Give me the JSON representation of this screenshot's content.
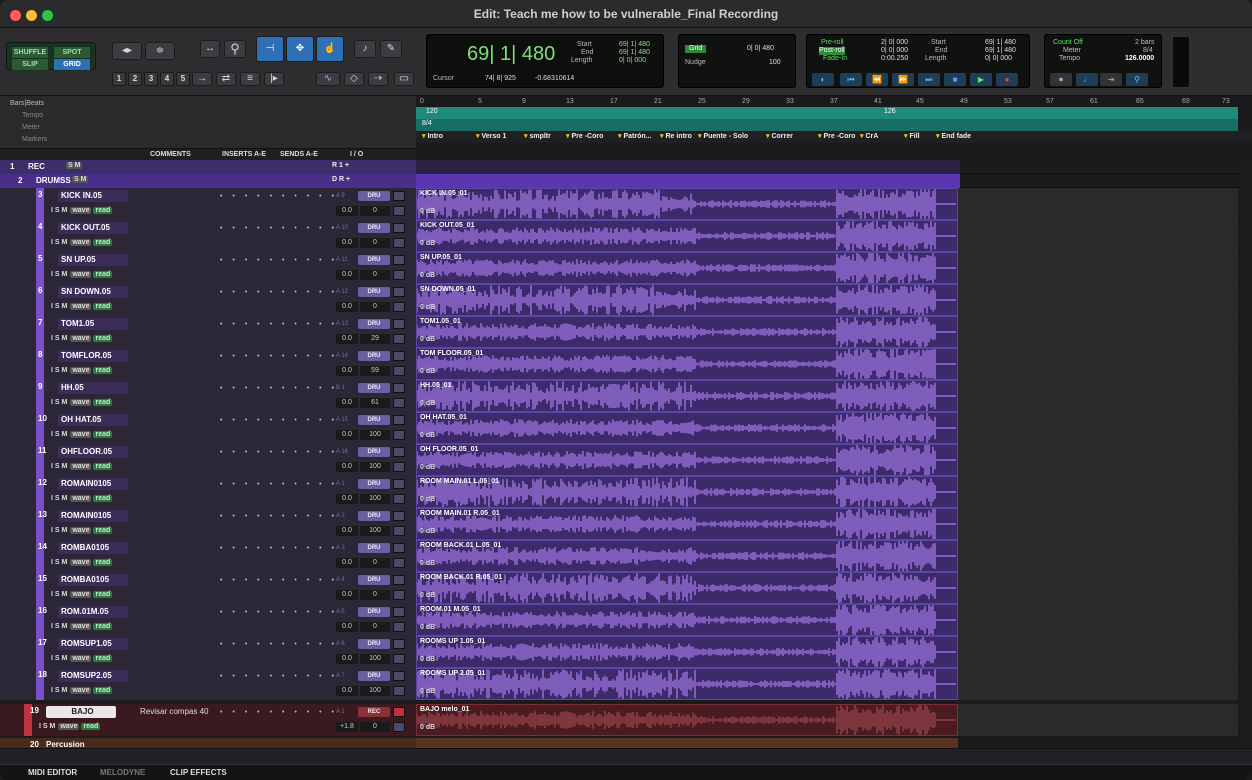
{
  "window": {
    "title": "Edit: Teach me how to be vulnerable_Final Recording"
  },
  "toolbar": {
    "modes": [
      "SHUFFLE",
      "SPOT",
      "SLIP",
      "GRID"
    ],
    "grid_nums": [
      "1",
      "2",
      "3",
      "4",
      "5"
    ],
    "counter": {
      "main": "69| 1| 480",
      "start_label": "Start",
      "start": "69| 1| 480",
      "end_label": "End",
      "end": "69| 1| 480",
      "length_label": "Length",
      "length": "0| 0| 000",
      "cursor_label": "Cursor",
      "cursor": "74| 8| 925",
      "cursor_db": "-0.68310614"
    },
    "grid": {
      "label": "Grid",
      "value": "0| 0| 480",
      "nudge_label": "Nudge",
      "nudge": "100"
    },
    "preroll": {
      "pre_label": "Pre-roll",
      "pre": "2| 0| 000",
      "post_label": "Post-roll",
      "post": "0| 0| 000",
      "fade_label": "Fade-In",
      "fade": "0:00.250",
      "start_label": "Start",
      "start": "69| 1| 480",
      "end_label": "End",
      "end": "69| 1| 480",
      "length_label": "Length",
      "length": "0| 0| 000"
    },
    "count": {
      "label": "Count Off",
      "bars": "2 bars",
      "meter_label": "Meter",
      "meter": "8/4",
      "tempo_label": "Tempo",
      "tempo": "126.0000"
    }
  },
  "rulers": {
    "barsbeats": "Bars|Beats",
    "tempo": "Tempo",
    "meter": "Meter",
    "markers": "Markers",
    "bars": [
      "0",
      "5",
      "9",
      "13",
      "17",
      "21",
      "25",
      "29",
      "33",
      "37",
      "41",
      "45",
      "49",
      "53",
      "57",
      "61",
      "65",
      "69",
      "73"
    ],
    "tempo_a": "120",
    "tempo_b": "126",
    "meter_val": "8/4",
    "marker_list": [
      {
        "label": "Intro"
      },
      {
        "label": "Verso 1"
      },
      {
        "label": "smpltr"
      },
      {
        "label": "Pre -Coro"
      },
      {
        "label": "Patrón..."
      },
      {
        "label": "Re intro"
      },
      {
        "label": "Puente - Solo"
      },
      {
        "label": "Correr"
      },
      {
        "label": "Pre -Coro"
      },
      {
        "label": "CrA"
      },
      {
        "label": "Fill"
      },
      {
        "label": "End fade"
      }
    ]
  },
  "columns": {
    "comments": "COMMENTS",
    "inserts": "INSERTS A-E",
    "sends": "SENDS A-E",
    "io": "I / O"
  },
  "groups": [
    {
      "num": "1",
      "name": "REC",
      "flags": "S M",
      "io": "R 1 +"
    },
    {
      "num": "2",
      "name": "DRUMSS",
      "flags": "S M",
      "io": "D R +"
    }
  ],
  "tracks": [
    {
      "num": "3",
      "name": "KICK IN.05",
      "clip": "KICK IN.05_01",
      "gain": "0 dB",
      "input": "A 9",
      "out": "DRU",
      "vol": "0.0",
      "pan": "0"
    },
    {
      "num": "4",
      "name": "KICK OUT.05",
      "clip": "KICK OUT.05_01",
      "gain": "0 dB",
      "input": "A 10",
      "out": "DRU",
      "vol": "0.0",
      "pan": "0"
    },
    {
      "num": "5",
      "name": "SN UP.05",
      "clip": "SN UP.05_01",
      "gain": "0 dB",
      "input": "A 11",
      "out": "DRU",
      "vol": "0.0",
      "pan": "0"
    },
    {
      "num": "6",
      "name": "SN DOWN.05",
      "clip": "SN DOWN.05_01",
      "gain": "0 dB",
      "input": "A 12",
      "out": "DRU",
      "vol": "0.0",
      "pan": "0"
    },
    {
      "num": "7",
      "name": "TOM1.05",
      "clip": "TOM1.05_01",
      "gain": "0 dB",
      "input": "A 13",
      "out": "DRU",
      "vol": "0.0",
      "pan": "29"
    },
    {
      "num": "8",
      "name": "TOMFLOR.05",
      "clip": "TOM FLOOR.05_01",
      "gain": "0 dB",
      "input": "A 14",
      "out": "DRU",
      "vol": "0.0",
      "pan": "59"
    },
    {
      "num": "9",
      "name": "HH.05",
      "clip": "HH.05_01",
      "gain": "0 dB",
      "input": "B 1",
      "out": "DRU",
      "vol": "0.0",
      "pan": "61"
    },
    {
      "num": "10",
      "name": "OH HAT.05",
      "clip": "OH HAT.05_01",
      "gain": "0 dB",
      "input": "A 15",
      "out": "DRU",
      "vol": "0.0",
      "pan": "100"
    },
    {
      "num": "11",
      "name": "OHFLOOR.05",
      "clip": "OH FLOOR.05_01",
      "gain": "0 dB",
      "input": "A 16",
      "out": "DRU",
      "vol": "0.0",
      "pan": "100"
    },
    {
      "num": "12",
      "name": "ROMAIN0105",
      "clip": "ROOM MAIN.01 L.05_01",
      "gain": "0 dB",
      "input": "A 1",
      "out": "DRU",
      "vol": "0.0",
      "pan": "100"
    },
    {
      "num": "13",
      "name": "ROMAIN0105",
      "clip": "ROOM MAIN.01 R.05_01",
      "gain": "0 dB",
      "input": "A 2",
      "out": "DRU",
      "vol": "0.0",
      "pan": "100"
    },
    {
      "num": "14",
      "name": "ROMBA0105",
      "clip": "ROOM BACK.01 L.05_01",
      "gain": "0 dB",
      "input": "A 3",
      "out": "DRU",
      "vol": "0.0",
      "pan": "0"
    },
    {
      "num": "15",
      "name": "ROMBA0105",
      "clip": "ROOM BACK.01 R.05_01",
      "gain": "0 dB",
      "input": "A 4",
      "out": "DRU",
      "vol": "0.0",
      "pan": "0"
    },
    {
      "num": "16",
      "name": "ROM.01M.05",
      "clip": "ROOM.01 M.05_01",
      "gain": "0 dB",
      "input": "A 5",
      "out": "DRU",
      "vol": "0.0",
      "pan": "0"
    },
    {
      "num": "17",
      "name": "ROMSUP1.05",
      "clip": "ROOMS UP 1.05_01",
      "gain": "0 dB",
      "input": "A 6",
      "out": "DRU",
      "vol": "0.0",
      "pan": "100"
    },
    {
      "num": "18",
      "name": "ROMSUP2.05",
      "clip": "ROOMS UP 2.05_01",
      "gain": "0 dB",
      "input": "A 7",
      "out": "DRU",
      "vol": "0.0",
      "pan": "100"
    }
  ],
  "track_flags": {
    "ism": "I S M",
    "wave": "wave",
    "read": "read"
  },
  "bass": {
    "num": "19",
    "name": "BAJO",
    "comment": "Revisar compas 40",
    "clip": "BAJO melo_01",
    "gain": "0 dB",
    "input": "A 1",
    "out": "REC",
    "vol": "+1.8",
    "pan": "0"
  },
  "next_track": {
    "num": "20",
    "name": "Percusion"
  },
  "bottom_tabs": [
    "MIDI EDITOR",
    "MELODYNE",
    "CLIP EFFECTS"
  ]
}
